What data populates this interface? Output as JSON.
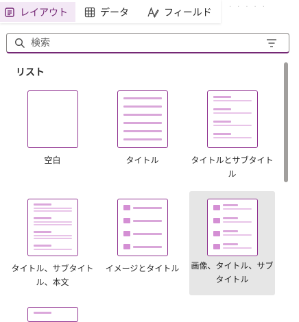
{
  "tabs": [
    {
      "label": "レイアウト",
      "icon": "layout-icon",
      "active": true
    },
    {
      "label": "データ",
      "icon": "table-grid-icon",
      "active": false
    },
    {
      "label": "フィールド",
      "icon": "fields-icon",
      "active": false
    }
  ],
  "search": {
    "placeholder": "検索",
    "value": ""
  },
  "section": {
    "title": "リスト"
  },
  "layouts": [
    {
      "label": "空白"
    },
    {
      "label": "タイトル"
    },
    {
      "label": "タイトルとサブタイトル"
    },
    {
      "label": "タイトル、サブタイトル、本文"
    },
    {
      "label": "イメージとタイトル"
    },
    {
      "label": "画像、タイトル、サブタイトル",
      "selected": true
    }
  ],
  "colors": {
    "accent": "#742774",
    "selected_bg": "#e6e6e6"
  }
}
